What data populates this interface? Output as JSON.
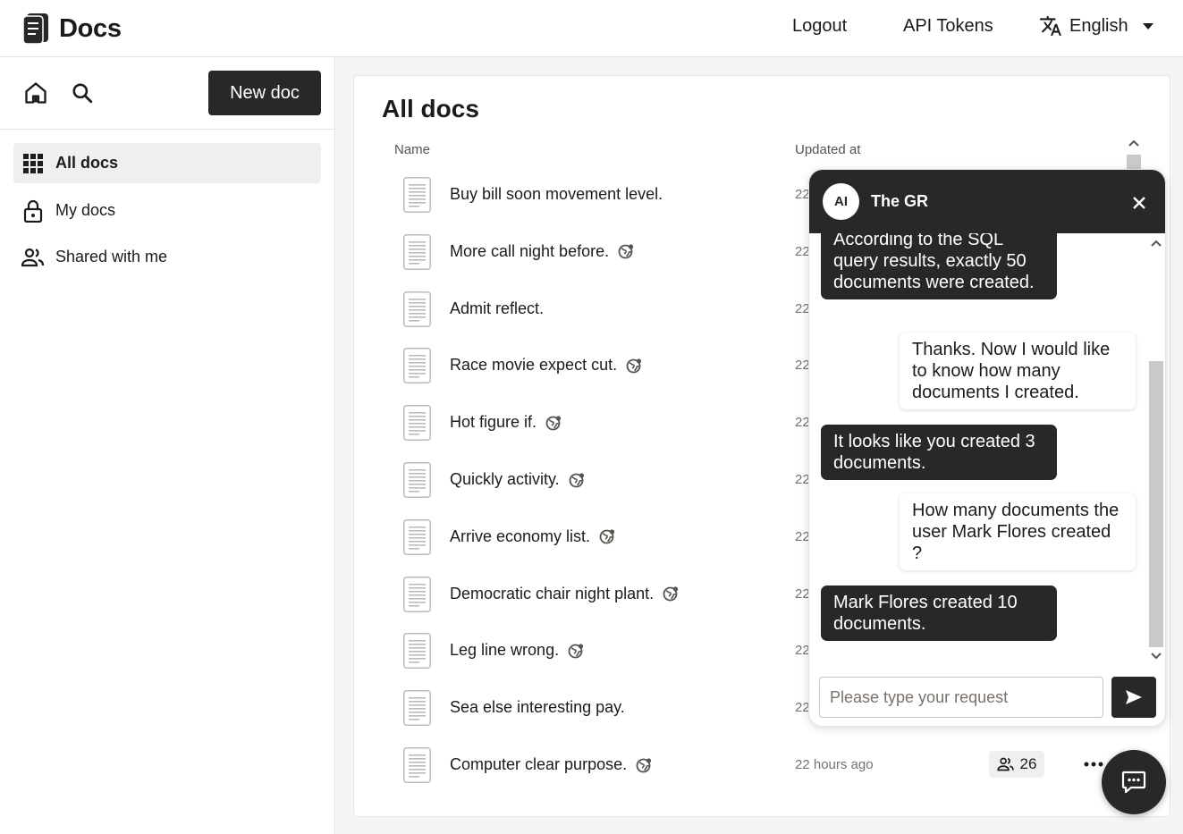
{
  "header": {
    "brand": "Docs",
    "logout": "Logout",
    "api_tokens": "API Tokens",
    "language": "English"
  },
  "sidebar": {
    "new_doc": "New doc",
    "items": [
      {
        "label": "All docs",
        "icon": "grid-icon",
        "active": true
      },
      {
        "label": "My docs",
        "icon": "lock-icon",
        "active": false
      },
      {
        "label": "Shared with me",
        "icon": "people-icon",
        "active": false
      }
    ]
  },
  "main": {
    "title": "All docs",
    "columns": {
      "name": "Name",
      "updated": "Updated at"
    },
    "rows": [
      {
        "title": "Buy bill soon movement level.",
        "public": false,
        "updated": "22"
      },
      {
        "title": "More call night before.",
        "public": true,
        "updated": "22"
      },
      {
        "title": "Admit reflect.",
        "public": false,
        "updated": "22"
      },
      {
        "title": "Race movie expect cut.",
        "public": true,
        "updated": "22"
      },
      {
        "title": "Hot figure if.",
        "public": true,
        "updated": "22"
      },
      {
        "title": "Quickly activity.",
        "public": true,
        "updated": "22"
      },
      {
        "title": "Arrive economy list.",
        "public": true,
        "updated": "22"
      },
      {
        "title": "Democratic chair night plant.",
        "public": true,
        "updated": "22"
      },
      {
        "title": "Leg line wrong.",
        "public": true,
        "updated": "22"
      },
      {
        "title": "Sea else interesting pay.",
        "public": false,
        "updated": "22"
      },
      {
        "title": "Computer clear purpose.",
        "public": true,
        "updated": "22 hours ago"
      }
    ],
    "last_row_shares": "26"
  },
  "chat": {
    "avatar": "AI",
    "name": "The GR",
    "messages": [
      {
        "role": "ai",
        "text": "According to the SQL query results, exactly 50 documents were created."
      },
      {
        "role": "user",
        "text": "Thanks. Now I would like to know how many documents I created."
      },
      {
        "role": "ai",
        "text": "It looks like you created 3 documents."
      },
      {
        "role": "user",
        "text": "How many documents the user Mark Flores created ?"
      },
      {
        "role": "ai",
        "text": "Mark Flores created 10 documents."
      }
    ],
    "input_placeholder": "Please type your request"
  },
  "colors": {
    "dark": "#2a2826",
    "border": "#e7e5e4",
    "muted": "#78716c"
  }
}
